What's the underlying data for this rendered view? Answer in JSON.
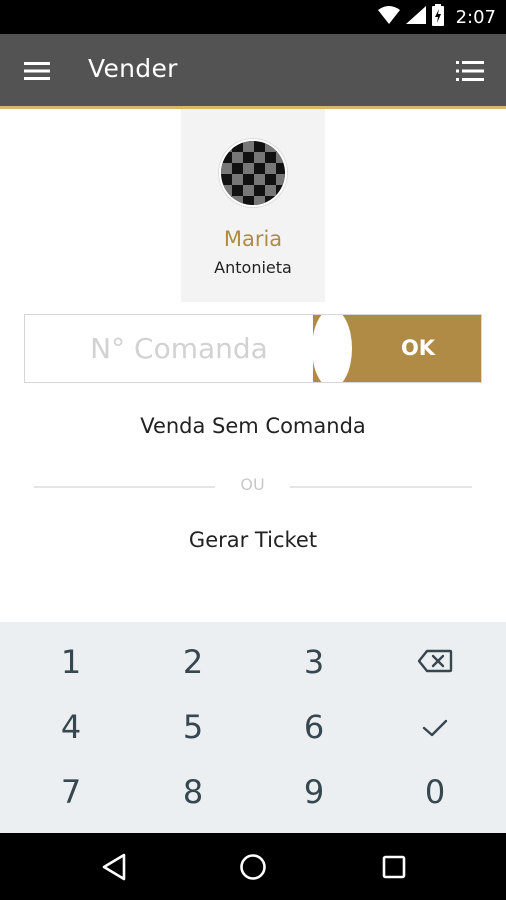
{
  "status_bar": {
    "time": "2:07",
    "icons": [
      "wifi-icon",
      "signal-icon",
      "battery-charging-icon"
    ]
  },
  "app_bar": {
    "title": "Vender",
    "menu_icon": "hamburger-menu-icon",
    "action_icon": "list-icon",
    "accent_color": "#d6b86a",
    "background": "#535353"
  },
  "profile": {
    "first_name": "Maria",
    "last_name": "Antonieta",
    "name_color": "#b08b45"
  },
  "comanda": {
    "placeholder": "N° Comanda",
    "value": "",
    "ok_label": "OK",
    "ok_color": "#b08b45"
  },
  "actions": {
    "venda_sem_comanda": "Venda Sem Comanda",
    "divider": "OU",
    "gerar_ticket": "Gerar Ticket"
  },
  "keypad": {
    "keys": [
      [
        "1",
        "2",
        "3",
        "backspace-icon"
      ],
      [
        "4",
        "5",
        "6",
        "check-icon"
      ],
      [
        "7",
        "8",
        "9",
        "0"
      ]
    ],
    "k1": "1",
    "k2": "2",
    "k3": "3",
    "k4": "4",
    "k5": "5",
    "k6": "6",
    "k7": "7",
    "k8": "8",
    "k9": "9",
    "k0": "0"
  },
  "nav_bar": {
    "icons": [
      "back-icon",
      "home-icon",
      "recents-icon"
    ]
  }
}
